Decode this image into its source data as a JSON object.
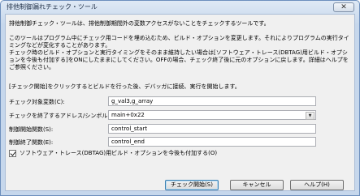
{
  "window": {
    "title": "排他制御漏れチェック・ツール",
    "close_label": "✕"
  },
  "description": "排他制御チェック・ツールは、排他制御期間外の変数アクセスがないことをチェックするツールです。\n\nこのツールはプログラム中にチェック用コードを埋め込むため、ビルド・オプションを変更します。それによりプログラムの実行タイミングなどが変化することがあります。\nチェック時のビルド・オプションと実行タイミングをそのまま維持したい場合は[ソフトウェア・トレース(DBTAG)用ビルド・オプションを今後も付加する]をONにしたままにしてください。OFFの場合、チェック終了後に元のオプションに戻します。詳細はヘルプをご参照ください。",
  "note": "[チェック開始]をクリックするとビルドを行った後、デバッガに接続、実行を開始します。",
  "form": {
    "target_var_label": "チェック対象変数(C):",
    "target_var_value": "g_val3,g_array",
    "end_addr_label": "チェックを終了するアドレス/シンボル(E)",
    "end_addr_value": "main+0x22",
    "start_func_label": "制御開始関数(S):",
    "start_func_value": "control_start",
    "end_func_label": "制御終了関数(E):",
    "end_func_value": "control_end"
  },
  "option": {
    "label": "ソフトウェア・トレース(DBTAG)用ビルド・オプションを今後も付加する(O)",
    "checked": true
  },
  "buttons": {
    "start": "チェック開始(S)",
    "cancel": "キャンセル",
    "help": "ヘルプ(H)"
  }
}
